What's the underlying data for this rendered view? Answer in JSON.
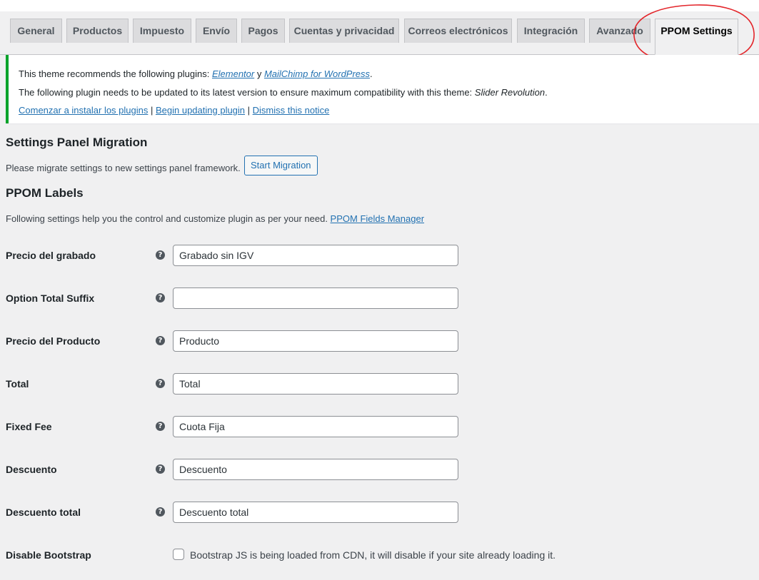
{
  "tabs": [
    {
      "label": "General",
      "active": false
    },
    {
      "label": "Productos",
      "active": false
    },
    {
      "label": "Impuesto",
      "active": false
    },
    {
      "label": "Envío",
      "active": false
    },
    {
      "label": "Pagos",
      "active": false
    },
    {
      "label": "Cuentas y privacidad",
      "active": false
    },
    {
      "label": "Correos electrónicos",
      "active": false
    },
    {
      "label": "Integración",
      "active": false
    },
    {
      "label": "Avanzado",
      "active": false
    },
    {
      "label": "PPOM Settings",
      "active": true
    }
  ],
  "notice": {
    "line1_prefix": "This theme recommends the following plugins: ",
    "plugin1": "Elementor",
    "conj": " y ",
    "plugin2": "MailChimp for WordPress",
    "line1_suffix": ".",
    "line2_prefix": "The following plugin needs to be updated to its latest version to ensure maximum compatibility with this theme: ",
    "line2_plugin": "Slider Revolution",
    "line2_suffix": ".",
    "link_install": "Comenzar a instalar los plugins",
    "sep": " | ",
    "link_update": "Begin updating plugin",
    "link_dismiss": "Dismiss this notice"
  },
  "migration": {
    "title": "Settings Panel Migration",
    "description": "Please migrate settings to new settings panel framework.",
    "button": "Start Migration"
  },
  "labels_section": {
    "title": "PPOM Labels",
    "description": "Following settings help you the control and customize plugin as per your need. ",
    "link": "PPOM Fields Manager"
  },
  "fields": [
    {
      "label": "Precio del grabado",
      "value": "Grabado sin IGV"
    },
    {
      "label": "Option Total Suffix",
      "value": ""
    },
    {
      "label": "Precio del Producto",
      "value": "Producto"
    },
    {
      "label": "Total",
      "value": "Total"
    },
    {
      "label": "Fixed Fee",
      "value": "Cuota Fija"
    },
    {
      "label": "Descuento",
      "value": "Descuento"
    },
    {
      "label": "Descuento total",
      "value": "Descuento total"
    }
  ],
  "help_glyph": "?",
  "disable_bootstrap": {
    "label": "Disable Bootstrap",
    "checkbox_text": "Bootstrap JS is being loaded from CDN, it will disable if your site already loading it.",
    "checked": false
  },
  "colors": {
    "notice_border": "#00a32a",
    "link": "#2271b1",
    "annotation": "#e3262b"
  }
}
